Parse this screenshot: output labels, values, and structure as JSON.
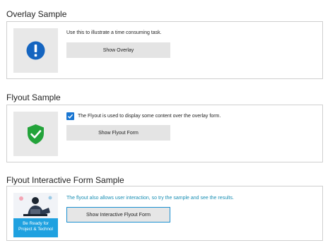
{
  "overlay_section": {
    "title": "Overlay Sample",
    "description": "Use this to illustrate a time consuming task.",
    "button_label": "Show Overlay"
  },
  "flyout_section": {
    "title": "Flyout Sample",
    "checkbox_checked": true,
    "checkbox_label": "The Flyout is used to display some content over the overlay form.",
    "button_label": "Show Flyout Form"
  },
  "interactive_section": {
    "title": "Flyout Interactive Form Sample",
    "description": "The flyout also allows user interaction, so try the sample and see the results.",
    "button_label": "Show Interactive Flyout Form",
    "promo_line1": "Be Ready for",
    "promo_line2": "Project & Technol"
  },
  "colors": {
    "info_icon": "#1565c0",
    "shield_icon": "#23a33a",
    "checkbox": "#1976d2",
    "link_text": "#1a8fb4",
    "promo_banner": "#1fa1e0",
    "button_focus_border": "#1a8fd0"
  },
  "icons": [
    "info-icon",
    "shield-check-icon",
    "checkmark-icon"
  ]
}
